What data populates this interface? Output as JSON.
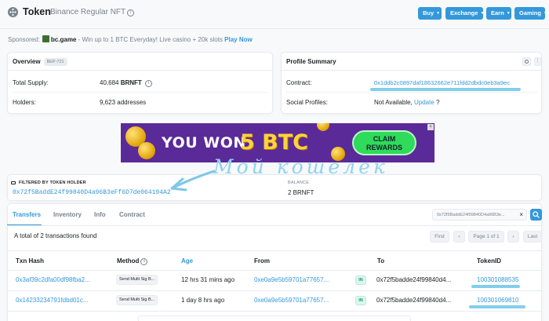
{
  "header": {
    "title": "Token",
    "subtitle": "Binance Regular NFT",
    "nav": [
      {
        "label": "Buy"
      },
      {
        "label": "Exchange"
      },
      {
        "label": "Earn"
      },
      {
        "label": "Gaming"
      }
    ]
  },
  "sponsor": {
    "prefix": "Sponsored:",
    "brand": "bc.game",
    "text": " - Win up to 1 BTC Everyday! Live casino + 20k slots ",
    "cta": "Play Now"
  },
  "overview": {
    "title": "Overview",
    "badge": "BEP-721",
    "total_supply_label": "Total Supply:",
    "total_supply_value": "40,684",
    "total_supply_unit": "BRNFT",
    "holders_label": "Holders:",
    "holders_value": "9,623 addresses"
  },
  "profile": {
    "title": "Profile Summary",
    "contract_label": "Contract:",
    "contract_value": "0x1ddb2c0897daf18632662e711fdd2dbdc0eb3a9ec",
    "social_label": "Social Profiles:",
    "social_value": "Not Available, ",
    "social_link": "Update",
    "social_suffix": " ?"
  },
  "banner": {
    "you_won": "YOU WON",
    "amount": "5 BTC",
    "claim_line1": "CLAIM",
    "claim_line2": "REWARDS"
  },
  "handwriting": {
    "text": "Мой кошелек"
  },
  "filter": {
    "label": "FILTERED BY TOKEN HOLDER",
    "address": "0x72f5BaddE24f99840D4a96B3eFf6D7de064194A2",
    "balance_label": "BALANCE",
    "balance_value": "2 BRNFT"
  },
  "tabs": [
    {
      "label": "Transfers"
    },
    {
      "label": "Inventory"
    },
    {
      "label": "Info"
    },
    {
      "label": "Contract"
    }
  ],
  "search": {
    "value": "0x72f5BaddE24f99840D4a96B3e..."
  },
  "summary": "A total of 2 transactions found",
  "pagination": {
    "first": "First",
    "page": "Page 1 of 1",
    "last": "Last"
  },
  "table": {
    "headers": [
      "Txn Hash",
      "Method",
      "Age",
      "From",
      "To",
      "TokenID"
    ],
    "rows": [
      {
        "hash": "0x3af39c2dfa00df98fba2...",
        "method": "Send Multi Sig B...",
        "age": "12 hrs 31 mins ago",
        "from": "0xe0a9e5b59701a77657...",
        "dir": "IN",
        "to": "0x72f5badde24f99840d4...",
        "token_id": "100301088535"
      },
      {
        "hash": "0x14233234791fdbd01c...",
        "method": "Send Multi Sig B...",
        "age": "1 day 8 hrs ago",
        "from": "0xe0a9e5b59701a77657...",
        "dir": "IN",
        "to": "0x72f5badde24f99840d4...",
        "token_id": "100301069810"
      }
    ]
  },
  "colors": {
    "accent": "#3498db",
    "highlight": "#6cc6e8",
    "in_badge": "#00a186"
  }
}
